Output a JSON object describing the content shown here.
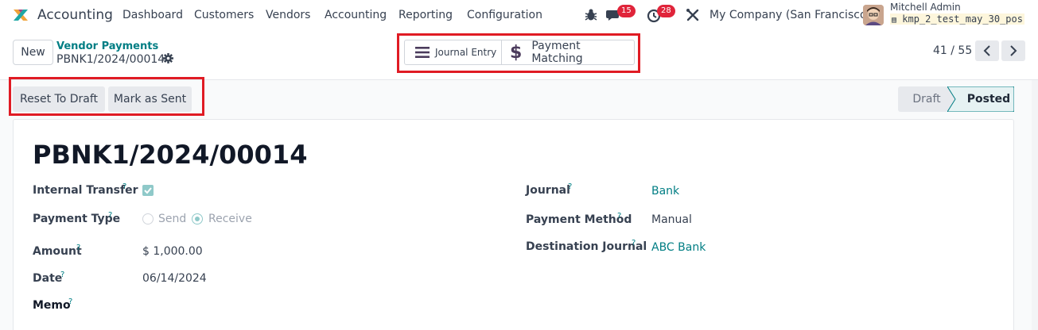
{
  "navbar": {
    "app_name": "Accounting",
    "menus": [
      "Dashboard",
      "Customers",
      "Vendors",
      "Accounting",
      "Reporting",
      "Configuration"
    ],
    "messages_count": "15",
    "activities_count": "28",
    "company": "My Company (San Francisco)",
    "user_name": "Mitchell Admin",
    "database": "kmp_2_test_may_30_pos"
  },
  "control_panel": {
    "new_label": "New",
    "breadcrumb_parent": "Vendor Payments",
    "breadcrumb_current": "PBNK1/2024/00014",
    "smart_buttons": {
      "journal_entry": "Journal Entry",
      "payment_matching": "Payment Matching"
    },
    "pager": "41 / 55"
  },
  "actions": {
    "reset_to_draft": "Reset To Draft",
    "mark_as_sent": "Mark as Sent"
  },
  "status": {
    "draft": "Draft",
    "posted": "Posted",
    "current": "Posted"
  },
  "form": {
    "title": "PBNK1/2024/00014",
    "left": {
      "internal_transfer_label": "Internal Transfer",
      "internal_transfer_checked": true,
      "payment_type_label": "Payment Type",
      "payment_type_options": [
        "Send",
        "Receive"
      ],
      "payment_type_selected": "Receive",
      "amount_label": "Amount",
      "amount_value": "$ 1,000.00",
      "date_label": "Date",
      "date_value": "06/14/2024",
      "memo_label": "Memo"
    },
    "right": {
      "journal_label": "Journal",
      "journal_value": "Bank",
      "payment_method_label": "Payment Method",
      "payment_method_value": "Manual",
      "destination_journal_label": "Destination Journal",
      "destination_journal_value": "ABC Bank"
    },
    "tip": "?"
  },
  "colors": {
    "accent": "#017e84",
    "highlight": "#e01b24",
    "badge": "#e0243a"
  }
}
